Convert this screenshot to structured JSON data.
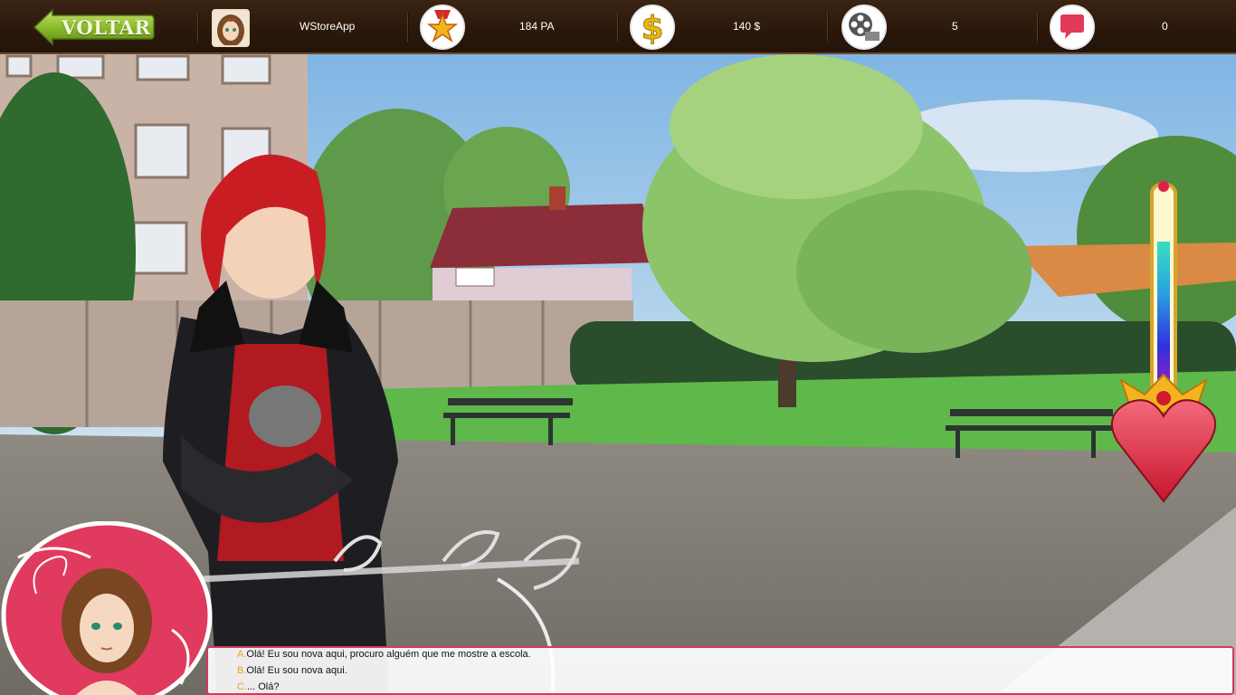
{
  "topbar": {
    "back_label": "VOLTAR",
    "player_name": "WStoreApp",
    "action_points": "184 PA",
    "money": "140 $",
    "films": "5",
    "messages": "0"
  },
  "icons": {
    "back": "back-arrow-icon",
    "avatar": "player-avatar",
    "ap": "star-medal-icon",
    "money": "dollar-icon",
    "films": "film-reel-icon",
    "messages": "speech-bubble-icon"
  },
  "love_meter": {
    "level": 0.75
  },
  "choices": [
    {
      "letter": "A.",
      "text": "Olá! Eu sou nova aqui, procuro alguém que me mostre a escola."
    },
    {
      "letter": "B.",
      "text": "Olá! Eu sou nova aqui."
    },
    {
      "letter": "C.",
      "text": "... Olá?"
    }
  ],
  "colors": {
    "accent": "#d8365e",
    "topbar": "#2a180b",
    "back_button": "#8cbc2c"
  }
}
